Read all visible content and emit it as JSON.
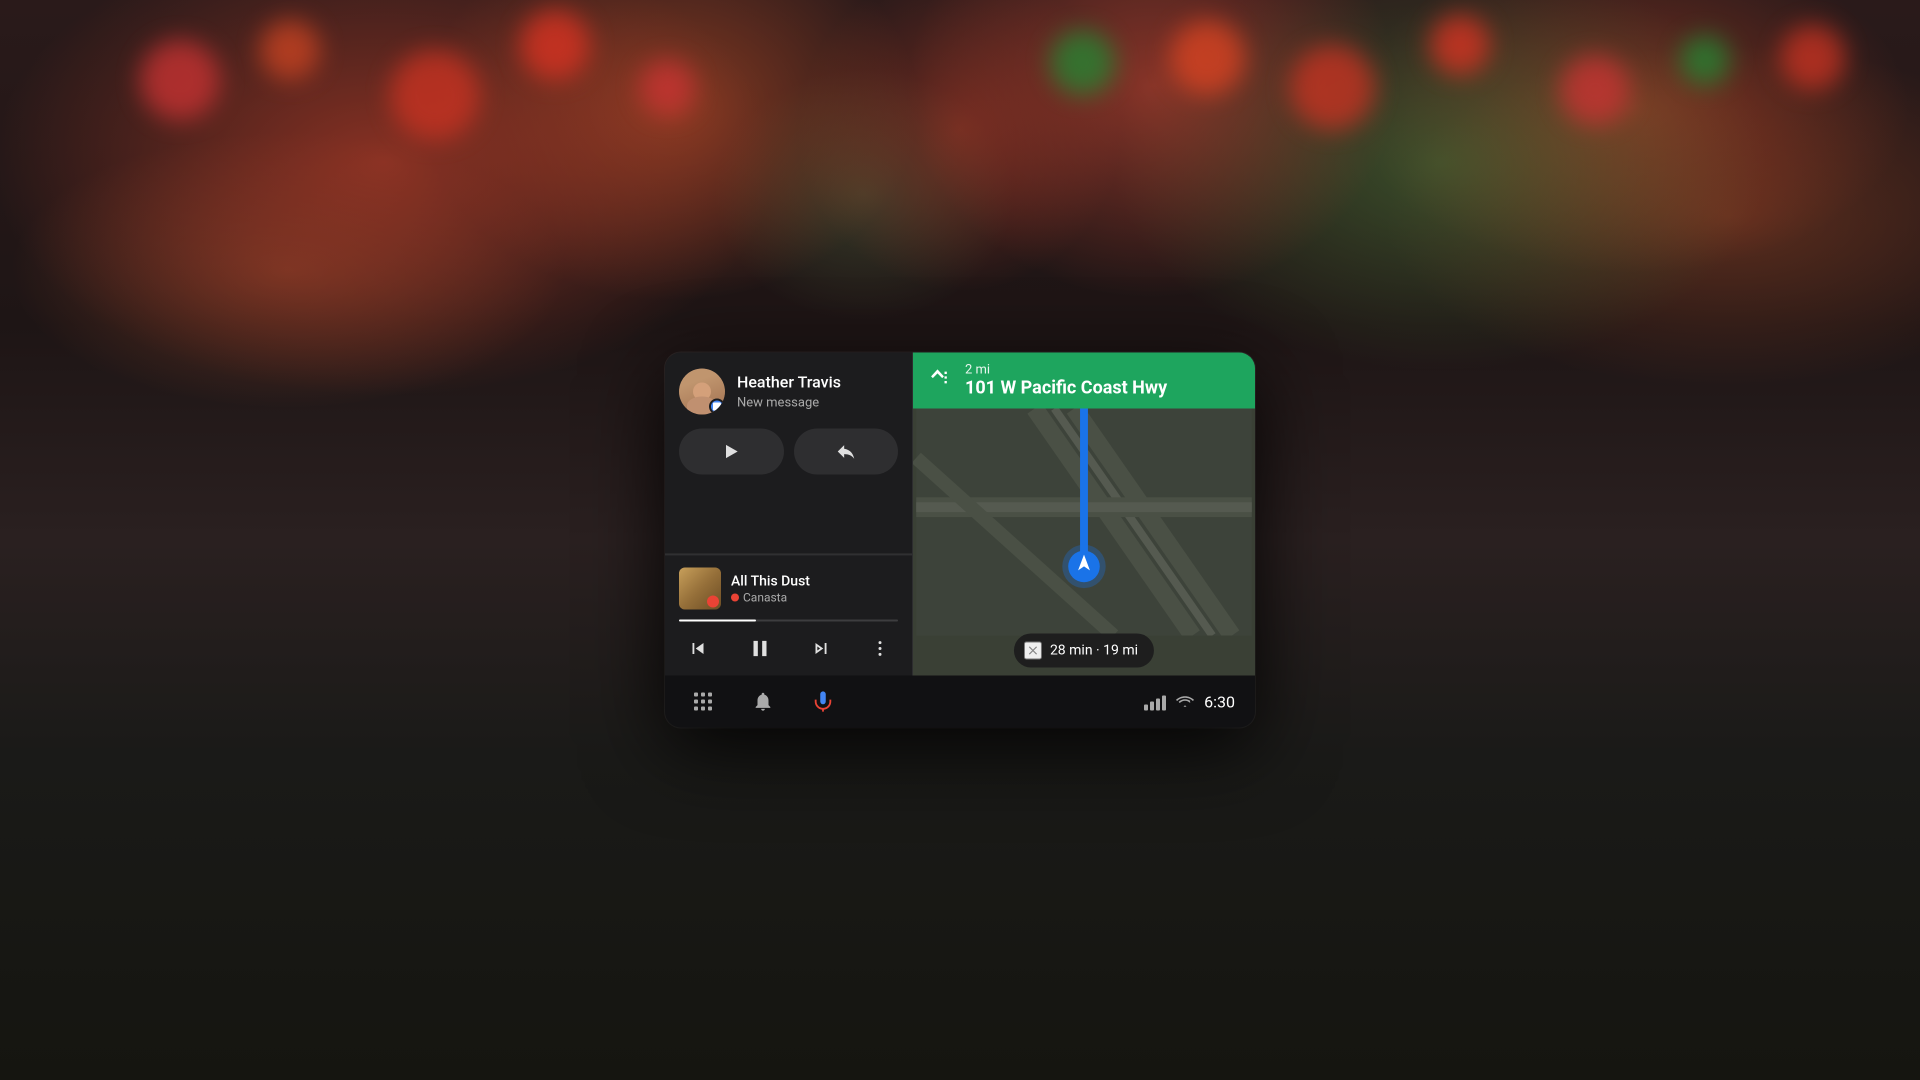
{
  "background": {
    "color": "#1a1a1a"
  },
  "message": {
    "sender": "Heather Travis",
    "subtitle": "New message",
    "play_label": "Play",
    "reply_label": "Reply"
  },
  "music": {
    "title": "All This Dust",
    "artist": "Canasta",
    "progress_percent": 35
  },
  "navigation": {
    "distance": "2 mi",
    "street": "101 W Pacific Coast Hwy",
    "eta": "28 min · 19 mi",
    "close_label": "×"
  },
  "bottom_bar": {
    "time": "6:30"
  },
  "icons": {
    "grid": "⠿",
    "bell": "🔔",
    "mic": "🎤",
    "prev": "⏮",
    "pause": "⏸",
    "next": "⏭",
    "more": "⋮",
    "play": "▶",
    "reply": "↩",
    "turn_left": "↩"
  }
}
